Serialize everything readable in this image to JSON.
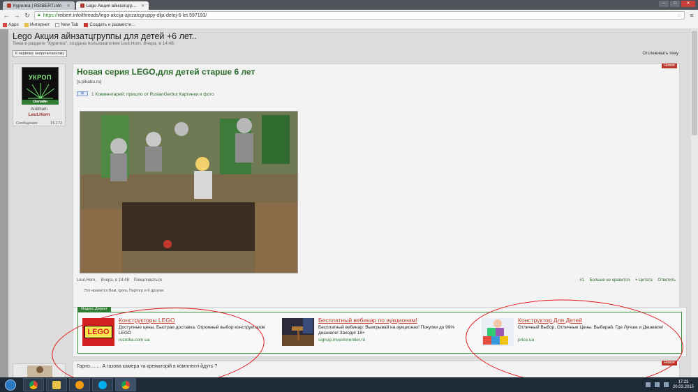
{
  "browser": {
    "tabs": [
      {
        "label": "Курилка | REIBERT.info",
        "active": false
      },
      {
        "label": "Lego Акция айнзатцгр...",
        "active": true
      }
    ],
    "url_scheme": "https://",
    "url_rest": "reibert.info/threads/lego-akcija-ajnzatcgruppy-dlja-detej-6-let.597193/",
    "bookmarks": [
      "Apps",
      "Интернет",
      "New Tab",
      "Создать и разместн..."
    ]
  },
  "thread": {
    "title": "Lego Акция айнзатцгруппы для детей +6 лет..",
    "subtitle": "Тема в разделе \"Курилка\", создана пользователем Leut.Horn, Вчера, в 14:48.",
    "first_unread": "К первому непрочитанному",
    "follow": "Отслеживать тему"
  },
  "user": {
    "avatar_text": "УКРОП",
    "online": "Онлайн",
    "title": "Anēthum",
    "name": "Leut.Horn",
    "msgs_label": "Сообщения:",
    "msgs_count": "15.172"
  },
  "post": {
    "new_badge": "Новое",
    "title": "Новая серия LEGO,для детей старше 6 лет",
    "source": "[s.pikabu.ru]",
    "meta_count": "1 Комментарий; пришло от",
    "meta_author": "RuslanGerbut",
    "meta_tags": "Картинки и фото",
    "footer_author": "Leut.Horn,",
    "footer_date": "Вчера, в 14:48",
    "footer_report": "Пожаловаться",
    "footer_num": "#1",
    "footer_dislike": "Больше не нравится",
    "footer_quote": "+ Цитата",
    "footer_reply": "Ответить",
    "likes": "Это нравится Вам, igora, Партогр и 6 другим."
  },
  "direct": {
    "tab": "Яндекс.Директ",
    "ads": [
      {
        "thumb": "lego-logo",
        "thumb_text": "LEGO",
        "title": "Конструкторы LEGO",
        "text": "Доступные цены. Быстрая доставка. Огромный выбор конструкторов LEGO",
        "url": "rozetka.com.ua"
      },
      {
        "thumb": "webinar-image",
        "title": "Бесплатный вебинар по аукционам!",
        "text": "Бесплатный вебинар: Выигрывай на аукционах! Покупки до 99% дешевле! Заходи! 18+",
        "url": "signup.investorentier.ru"
      },
      {
        "thumb": "blocks-image",
        "title": "Конструктор Для Детей",
        "text": "Отличный Выбор, Отличные Цены. Выбирай, Где Лучше и Дешевле!",
        "url": "price.ua"
      }
    ]
  },
  "reply": {
    "new_badge": "Новое",
    "text": "Гарно........ А газова камера та крематорій в комплекті йдуть ?"
  },
  "taskbar": {
    "time": "17:23",
    "date": "20.03.2015"
  },
  "colors": {
    "accent_green": "#2a6b2a",
    "badge_red": "#b9372d",
    "annotation_red": "#e0161b"
  }
}
